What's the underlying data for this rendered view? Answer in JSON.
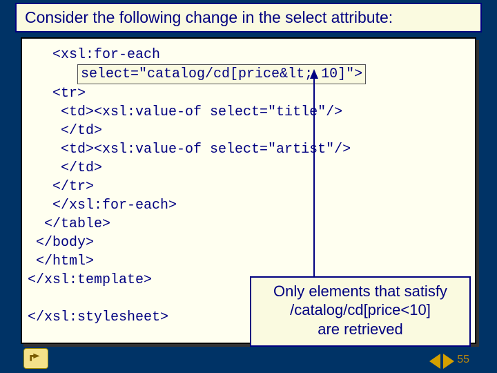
{
  "title": "Consider the following change in the select attribute:",
  "code": {
    "line1": "   <xsl:for-each",
    "line2_prefix": "      ",
    "line2_highlight": "select=\"catalog/cd[price&lt; 10]\">",
    "line3": "   <tr>",
    "line4": "    <td><xsl:value-of select=\"title\"/>",
    "line5": "    </td>",
    "line6": "    <td><xsl:value-of select=\"artist\"/>",
    "line7": "    </td>",
    "line8": "   </tr>",
    "line9": "   </xsl:for-each>",
    "line10": "  </table>",
    "line11": " </body>",
    "line12": " </html>",
    "line13": "</xsl:template>",
    "line14": "",
    "line15": "</xsl:stylesheet>"
  },
  "callout": {
    "l1": "Only elements that satisfy",
    "l2": "/catalog/cd[price<10]",
    "l3": "are retrieved"
  },
  "page_number": "55"
}
